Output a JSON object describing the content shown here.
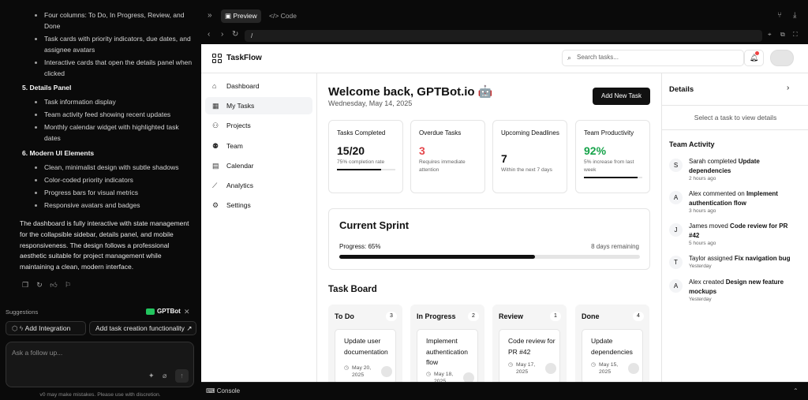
{
  "chat": {
    "bullets_top": [
      {
        "text": "Four columns: To Do, In Progress, Review, and Done"
      },
      {
        "text": "Task cards with priority indicators, due dates, and assignee avatars"
      },
      {
        "text": "Interactive cards that open the details panel when clicked"
      }
    ],
    "section5": "5.  Details Panel",
    "bullets_5": [
      {
        "text": "Task information display"
      },
      {
        "text": "Team activity feed showing recent updates"
      },
      {
        "text": "Monthly calendar widget with highlighted task dates"
      }
    ],
    "section6": "6.  Modern UI Elements",
    "bullets_6": [
      {
        "text": "Clean, minimalist design with subtle shadows"
      },
      {
        "text": "Color-coded priority indicators"
      },
      {
        "text": "Progress bars for visual metrics"
      },
      {
        "text": "Responsive avatars and badges"
      }
    ],
    "summary": "The dashboard is fully interactive with state management for the collapsible sidebar, details panel, and mobile responsiveness. The design follows a professional aesthetic suitable for project management while maintaining a clean, modern interface.",
    "suggestions_label": "Suggestions",
    "brand": "GPTBot",
    "chip_add_integration": "Add Integration",
    "chip_task_creation": "Add task creation functionality",
    "followup_placeholder": "Ask a follow up...",
    "disclaimer": "v0 may make mistakes. Please use with discretion."
  },
  "preview": {
    "tab_preview": "Preview",
    "tab_code": "Code",
    "url": "/",
    "console": "Console"
  },
  "app": {
    "logo": "TaskFlow",
    "search_placeholder": "Search tasks...",
    "nav": [
      {
        "label": "Dashboard",
        "icon": "home-icon"
      },
      {
        "label": "My Tasks",
        "icon": "grid-icon"
      },
      {
        "label": "Projects",
        "icon": "users-icon"
      },
      {
        "label": "Team",
        "icon": "team-icon"
      },
      {
        "label": "Calendar",
        "icon": "calendar-icon"
      },
      {
        "label": "Analytics",
        "icon": "chart-icon"
      },
      {
        "label": "Settings",
        "icon": "gear-icon"
      }
    ],
    "welcome": "Welcome back, GPTBot.io 🤖",
    "date": "Wednesday, May 14, 2025",
    "add_task": "Add New Task",
    "stats": [
      {
        "title": "Tasks Completed",
        "value": "15/20",
        "sub": "75% completion rate",
        "progress": 0.75
      },
      {
        "title": "Overdue Tasks",
        "value": "3",
        "sub": "Requires immediate attention"
      },
      {
        "title": "Upcoming Deadlines",
        "value": "7",
        "sub": "Within the next 7 days"
      },
      {
        "title": "Team Productivity",
        "value": "92%",
        "sub": "5% increase from last week",
        "progress": 0.92
      }
    ],
    "overdue_color": "#e5484d",
    "productivity_color": "#16a34a",
    "sprint": {
      "title": "Current Sprint",
      "progress_label": "Progress: 65%",
      "remaining": "8 days remaining",
      "progress": 0.65
    },
    "board_title": "Task Board",
    "columns": [
      {
        "name": "To Do",
        "count": "3",
        "card_title": "Update user documentation",
        "card_date": "May 20, 2025"
      },
      {
        "name": "In Progress",
        "count": "2",
        "card_title": "Implement authentication flow",
        "card_date": "May 18, 2025"
      },
      {
        "name": "Review",
        "count": "1",
        "card_title": "Code review for PR #42",
        "card_date": "May 17, 2025"
      },
      {
        "name": "Done",
        "count": "4",
        "card_title": "Update dependencies",
        "card_date": "May 15, 2025"
      }
    ],
    "details": {
      "title": "Details",
      "empty": "Select a task to view details",
      "activity_title": "Team Activity",
      "activity": [
        {
          "initial": "S",
          "name": "Sarah",
          "verb": "completed",
          "task": "Update dependencies",
          "time": "2 hours ago"
        },
        {
          "initial": "A",
          "name": "Alex",
          "verb": "commented on",
          "task": "Implement authentication flow",
          "time": "3 hours ago"
        },
        {
          "initial": "J",
          "name": "James",
          "verb": "moved",
          "task": "Code review for PR #42",
          "time": "5 hours ago"
        },
        {
          "initial": "T",
          "name": "Taylor",
          "verb": "assigned",
          "task": "Fix navigation bug",
          "time": "Yesterday"
        },
        {
          "initial": "A",
          "name": "Alex",
          "verb": "created",
          "task": "Design new feature mockups",
          "time": "Yesterday"
        }
      ]
    }
  }
}
